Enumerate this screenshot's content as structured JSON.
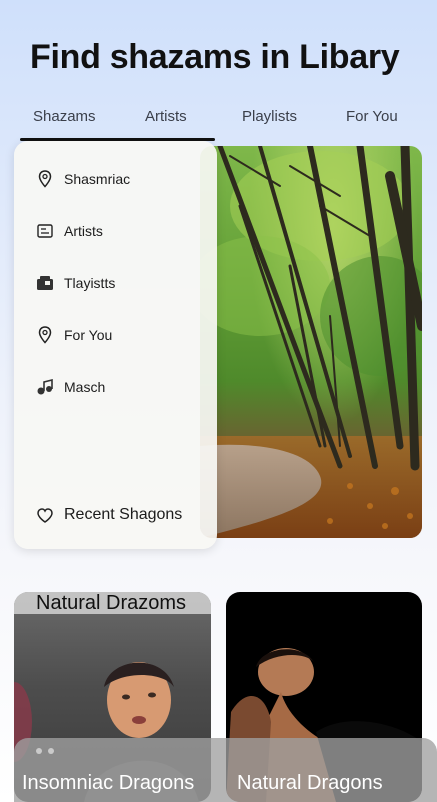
{
  "header": {
    "title": "Find shazams in Libary"
  },
  "tabs": [
    {
      "label": "Shazams"
    },
    {
      "label": "Artists"
    },
    {
      "label": "Playlists"
    },
    {
      "label": "For You"
    }
  ],
  "menu": {
    "items": [
      {
        "label": "Shasmriac",
        "icon": "location-pin-icon"
      },
      {
        "label": "Artists",
        "icon": "artist-card-icon"
      },
      {
        "label": "Tlayistts",
        "icon": "playlist-icon"
      },
      {
        "label": "For You",
        "icon": "location-pin-icon"
      },
      {
        "label": "Masch",
        "icon": "music-note-icon"
      }
    ],
    "recent": {
      "label": "Recent Shagons",
      "icon": "heart-icon"
    }
  },
  "cards": {
    "left": {
      "header": "Natural Drazoms",
      "footer": "Insomniac Dragons"
    },
    "right": {
      "footer": "Natural Dragons"
    }
  }
}
